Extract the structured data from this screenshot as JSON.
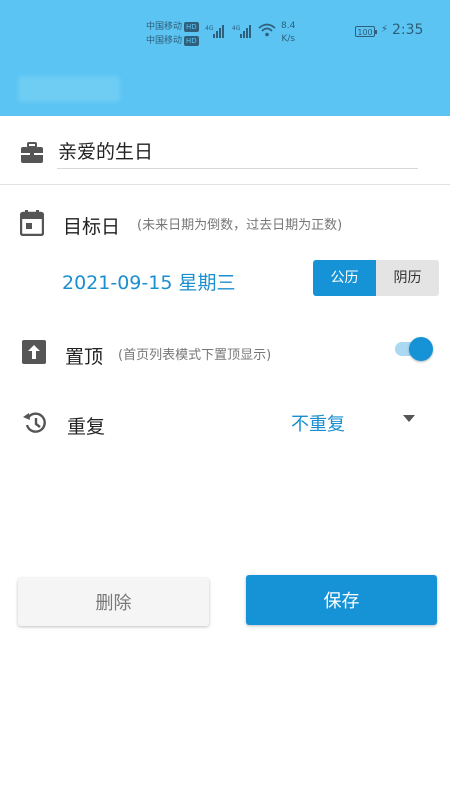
{
  "status_bar": {
    "carrier_1": "中国移动",
    "carrier_2": "中国移动",
    "hd_badge": "HD",
    "network_1": "4G",
    "network_2": "4G",
    "speed_value": "8.4",
    "speed_unit": "K/s",
    "battery": "100",
    "time": "2:35"
  },
  "event": {
    "title_value": "亲爱的生日"
  },
  "target_date": {
    "label": "目标日",
    "hint": "(未来日期为倒数，过去日期为正数)",
    "value": "2021-09-15 星期三",
    "calendar_options": [
      "公历",
      "阴历"
    ],
    "selected_calendar": "公历"
  },
  "pin_top": {
    "label": "置顶",
    "hint": "(首页列表模式下置顶显示)",
    "enabled": true
  },
  "repeat": {
    "label": "重复",
    "value": "不重复"
  },
  "actions": {
    "delete_label": "删除",
    "save_label": "保存"
  },
  "colors": {
    "header": "#5bc4f3",
    "accent": "#1593d6",
    "accent_text": "#1a8fcf"
  },
  "icons": {
    "title": "briefcase-icon",
    "date": "calendar-icon",
    "pin": "pin-top-icon",
    "repeat": "history-icon",
    "dropdown": "dropdown-arrow-icon"
  }
}
